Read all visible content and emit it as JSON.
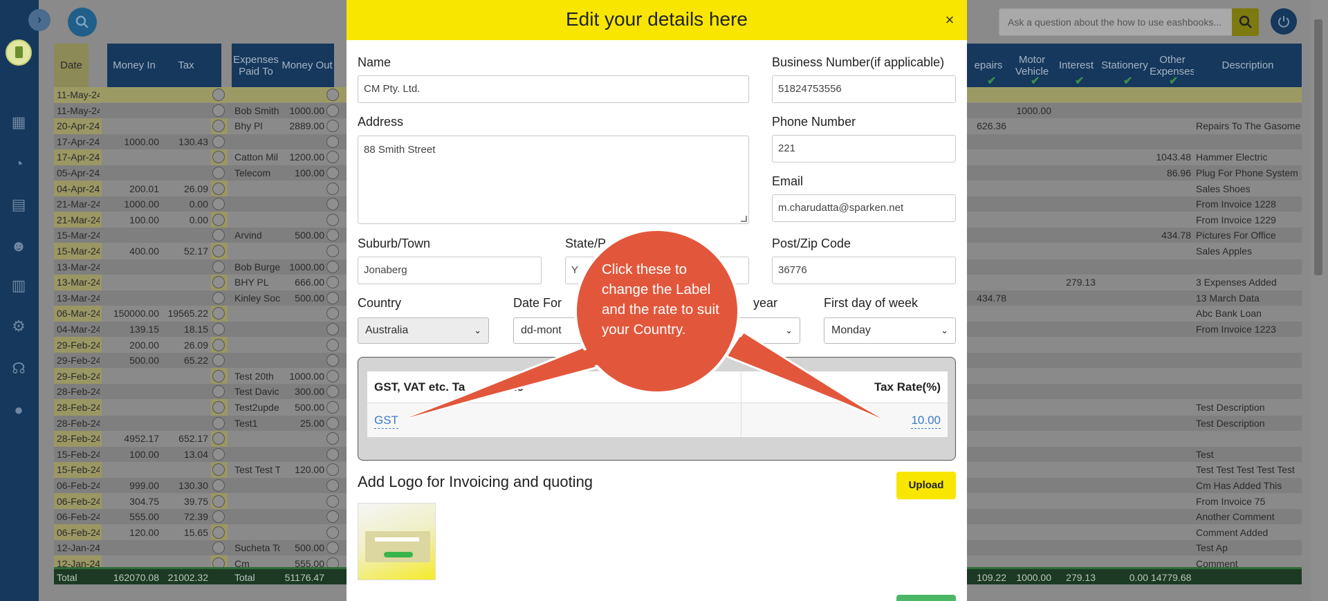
{
  "topbar": {
    "ask_placeholder": "Ask a question about the how to use eashbooks..."
  },
  "sidebar": {
    "icons": [
      "calendar-icon",
      "pie-chart-icon",
      "report-icon",
      "user-question-icon",
      "schedule-icon",
      "settings-chart-icon",
      "support-icon",
      "user-icon"
    ]
  },
  "grid": {
    "headers": {
      "date": "Date",
      "money_in": "Money In",
      "tax": "Tax",
      "expenses_paid_to": "Expenses Paid To",
      "money_out": "Money Out",
      "repairs": "epairs",
      "motor_vehicle": "Motor Vehicle",
      "interest": "Interest",
      "stationery": "Stationery",
      "other_expenses": "Other Expenses",
      "description": "Description"
    },
    "rows": [
      {
        "date": "11-May-24",
        "in": "",
        "tax": "",
        "paid_to": "",
        "out": "",
        "repairs": "",
        "motor": "",
        "interest": "",
        "other": "",
        "desc": ""
      },
      {
        "date": "11-May-24",
        "in": "",
        "tax": "",
        "paid_to": "Bob Smith",
        "out": "1000.00",
        "repairs": "",
        "motor": "1000.00",
        "interest": "",
        "other": "",
        "desc": ""
      },
      {
        "date": "20-Apr-24",
        "in": "",
        "tax": "",
        "paid_to": "Bhy Pl",
        "out": "2889.00",
        "repairs": "626.36",
        "motor": "",
        "interest": "",
        "other": "",
        "desc": "Repairs To The Gasome"
      },
      {
        "date": "17-Apr-24",
        "in": "1000.00",
        "tax": "130.43",
        "paid_to": "",
        "out": "",
        "repairs": "",
        "motor": "",
        "interest": "",
        "other": "",
        "desc": ""
      },
      {
        "date": "17-Apr-24",
        "in": "",
        "tax": "",
        "paid_to": "Catton Mil",
        "out": "1200.00",
        "repairs": "",
        "motor": "",
        "interest": "",
        "other": "1043.48",
        "desc": "Hammer Electric"
      },
      {
        "date": "05-Apr-24",
        "in": "",
        "tax": "",
        "paid_to": "Telecom",
        "out": "100.00",
        "repairs": "",
        "motor": "",
        "interest": "",
        "other": "86.96",
        "desc": "Plug For Phone System"
      },
      {
        "date": "04-Apr-24",
        "in": "200.01",
        "tax": "26.09",
        "paid_to": "",
        "out": "",
        "repairs": "",
        "motor": "",
        "interest": "",
        "other": "",
        "desc": "Sales Shoes"
      },
      {
        "date": "21-Mar-24",
        "in": "1000.00",
        "tax": "0.00",
        "paid_to": "",
        "out": "",
        "repairs": "",
        "motor": "",
        "interest": "",
        "other": "",
        "desc": "From Invoice 1228"
      },
      {
        "date": "21-Mar-24",
        "in": "100.00",
        "tax": "0.00",
        "paid_to": "",
        "out": "",
        "repairs": "",
        "motor": "",
        "interest": "",
        "other": "",
        "desc": "From Invoice 1229"
      },
      {
        "date": "15-Mar-24",
        "in": "",
        "tax": "",
        "paid_to": "Arvind",
        "out": "500.00",
        "repairs": "",
        "motor": "",
        "interest": "",
        "other": "434.78",
        "desc": "Pictures For Office"
      },
      {
        "date": "15-Mar-24",
        "in": "400.00",
        "tax": "52.17",
        "paid_to": "",
        "out": "",
        "repairs": "",
        "motor": "",
        "interest": "",
        "other": "",
        "desc": "Sales Apples"
      },
      {
        "date": "13-Mar-24",
        "in": "",
        "tax": "",
        "paid_to": "Bob Burge",
        "out": "1000.00",
        "repairs": "",
        "motor": "",
        "interest": "",
        "other": "",
        "desc": ""
      },
      {
        "date": "13-Mar-24",
        "in": "",
        "tax": "",
        "paid_to": "BHY PL",
        "out": "666.00",
        "repairs": "",
        "motor": "",
        "interest": "279.13",
        "other": "",
        "desc": "3 Expenses Added"
      },
      {
        "date": "13-Mar-24",
        "in": "",
        "tax": "",
        "paid_to": "Kinley Soc",
        "out": "500.00",
        "repairs": "434.78",
        "motor": "",
        "interest": "",
        "other": "",
        "desc": "13 March Data"
      },
      {
        "date": "06-Mar-24",
        "in": "150000.00",
        "tax": "19565.22",
        "paid_to": "",
        "out": "",
        "repairs": "",
        "motor": "",
        "interest": "",
        "other": "",
        "desc": "Abc Bank Loan"
      },
      {
        "date": "04-Mar-24",
        "in": "139.15",
        "tax": "18.15",
        "paid_to": "",
        "out": "",
        "repairs": "",
        "motor": "",
        "interest": "",
        "other": "",
        "desc": "From Invoice 1223"
      },
      {
        "date": "29-Feb-24",
        "in": "200.00",
        "tax": "26.09",
        "paid_to": "",
        "out": "",
        "repairs": "",
        "motor": "",
        "interest": "",
        "other": "",
        "desc": ""
      },
      {
        "date": "29-Feb-24",
        "in": "500.00",
        "tax": "65.22",
        "paid_to": "",
        "out": "",
        "repairs": "",
        "motor": "",
        "interest": "",
        "other": "",
        "desc": ""
      },
      {
        "date": "29-Feb-24",
        "in": "",
        "tax": "",
        "paid_to": "Test 20th",
        "out": "1000.00",
        "repairs": "",
        "motor": "",
        "interest": "",
        "other": "",
        "desc": ""
      },
      {
        "date": "28-Feb-24",
        "in": "",
        "tax": "",
        "paid_to": "Test Davic",
        "out": "300.00",
        "repairs": "",
        "motor": "",
        "interest": "",
        "other": "",
        "desc": ""
      },
      {
        "date": "28-Feb-24",
        "in": "",
        "tax": "",
        "paid_to": "Test2upde",
        "out": "500.00",
        "repairs": "",
        "motor": "",
        "interest": "",
        "other": "",
        "desc": "Test Description"
      },
      {
        "date": "28-Feb-24",
        "in": "",
        "tax": "",
        "paid_to": "Test1",
        "out": "25.00",
        "repairs": "",
        "motor": "",
        "interest": "",
        "other": "",
        "desc": "Test Description"
      },
      {
        "date": "28-Feb-24",
        "in": "4952.17",
        "tax": "652.17",
        "paid_to": "",
        "out": "",
        "repairs": "",
        "motor": "",
        "interest": "",
        "other": "",
        "desc": ""
      },
      {
        "date": "15-Feb-24",
        "in": "100.00",
        "tax": "13.04",
        "paid_to": "",
        "out": "",
        "repairs": "",
        "motor": "",
        "interest": "",
        "other": "",
        "desc": "Test"
      },
      {
        "date": "15-Feb-24",
        "in": "",
        "tax": "",
        "paid_to": "Test Test T",
        "out": "120.00",
        "repairs": "",
        "motor": "",
        "interest": "",
        "other": "",
        "desc": "Test Test Test Test Test"
      },
      {
        "date": "06-Feb-24",
        "in": "999.00",
        "tax": "130.30",
        "paid_to": "",
        "out": "",
        "repairs": "",
        "motor": "",
        "interest": "",
        "other": "",
        "desc": "Cm Has Added This"
      },
      {
        "date": "06-Feb-24",
        "in": "304.75",
        "tax": "39.75",
        "paid_to": "",
        "out": "",
        "repairs": "",
        "motor": "",
        "interest": "",
        "other": "",
        "desc": "From Invoice 75"
      },
      {
        "date": "06-Feb-24",
        "in": "555.00",
        "tax": "72.39",
        "paid_to": "",
        "out": "",
        "repairs": "",
        "motor": "",
        "interest": "",
        "other": "",
        "desc": "Another Comment"
      },
      {
        "date": "06-Feb-24",
        "in": "120.00",
        "tax": "15.65",
        "paid_to": "",
        "out": "",
        "repairs": "",
        "motor": "",
        "interest": "",
        "other": "",
        "desc": "Comment Added"
      },
      {
        "date": "12-Jan-24",
        "in": "",
        "tax": "",
        "paid_to": "Sucheta To",
        "out": "500.00",
        "repairs": "",
        "motor": "",
        "interest": "",
        "other": "",
        "desc": "Test Ap"
      },
      {
        "date": "12-Jan-24",
        "in": "",
        "tax": "",
        "paid_to": "Cm",
        "out": "555.00",
        "repairs": "",
        "motor": "",
        "interest": "",
        "other": "",
        "desc": "Comment"
      }
    ],
    "totals": {
      "label_left": "Total",
      "in": "162070.08",
      "tax": "21002.32",
      "label_right": "Total",
      "out": "51176.47",
      "repairs": "109.22",
      "motor": "1000.00",
      "interest": "279.13",
      "stationery": "0.00",
      "other": "14779.68"
    }
  },
  "modal": {
    "title": "Edit your details here",
    "close_glyph": "×",
    "name_label": "Name",
    "name_value": "CM Pty. Ltd.",
    "business_number_label": "Business Number(if applicable)",
    "business_number_value": "51824753556",
    "address_label": "Address",
    "address_value": "88 Smith Street",
    "phone_label": "Phone Number",
    "phone_value": "221",
    "email_label": "Email",
    "email_value": "m.charudatta@sparken.net",
    "suburb_label": "Suburb/Town",
    "suburb_value": "Jonaberg",
    "state_label": "State/P",
    "state_value": "Y",
    "postcode_label": "Post/Zip Code",
    "postcode_value": "36776",
    "country_label": "Country",
    "country_value": "Australia",
    "date_format_label": "Date For",
    "date_format_value": "dd-mont",
    "year_label": "year",
    "first_day_label": "First day of week",
    "first_day_value": "Monday",
    "tax_name_header": "GST, VAT etc. Ta",
    "tax_name_header_tail": "me",
    "tax_rate_header": "Tax Rate(%)",
    "tax_name_value": "GST",
    "tax_rate_value": "10.00",
    "logo_heading": "Add Logo for Invoicing and quoting",
    "upload_label": "Upload"
  },
  "callout": {
    "text": "Click these to change the Label and the rate to suit your Country.",
    "color": "#e2573b"
  },
  "colors": {
    "modal_header": "#f8e600",
    "sidebar": "#15385c",
    "link_blue": "#3b7bc6"
  }
}
